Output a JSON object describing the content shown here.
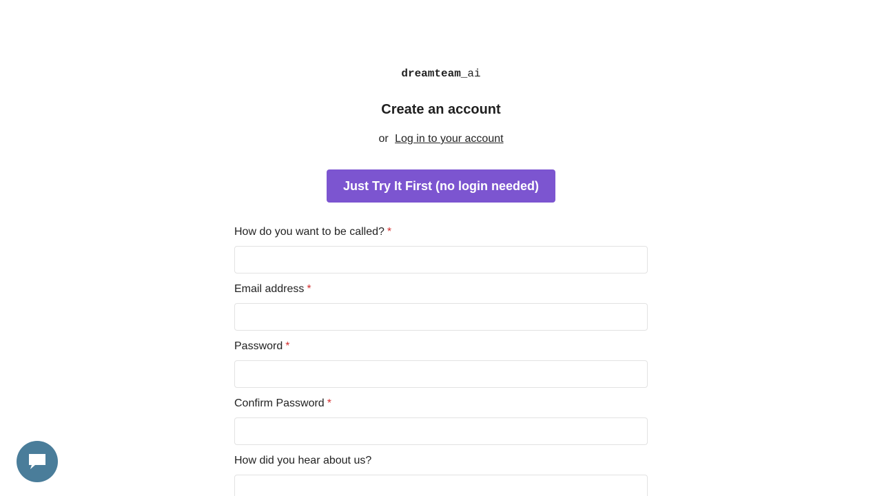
{
  "brand": {
    "logo_bold": "dreamteam",
    "logo_rest": "_ai"
  },
  "header": {
    "title": "Create an account",
    "or_text": "or",
    "login_link": "Log in to your account"
  },
  "cta": {
    "try_label": "Just Try It First (no login needed)",
    "color": "#7c55d0"
  },
  "form": {
    "fields": [
      {
        "label": "How do you want to be called?",
        "required": "*",
        "value": "",
        "placeholder": ""
      },
      {
        "label": "Email address",
        "required": "*",
        "value": "",
        "placeholder": ""
      },
      {
        "label": "Password",
        "required": "*",
        "value": "",
        "placeholder": ""
      },
      {
        "label": "Confirm Password",
        "required": "*",
        "value": "",
        "placeholder": ""
      },
      {
        "label": "How did you hear about us?",
        "value": "",
        "placeholder": ""
      }
    ]
  },
  "chat_widget": {
    "icon": "chat-bubble-icon",
    "color": "#4a7d9a"
  }
}
